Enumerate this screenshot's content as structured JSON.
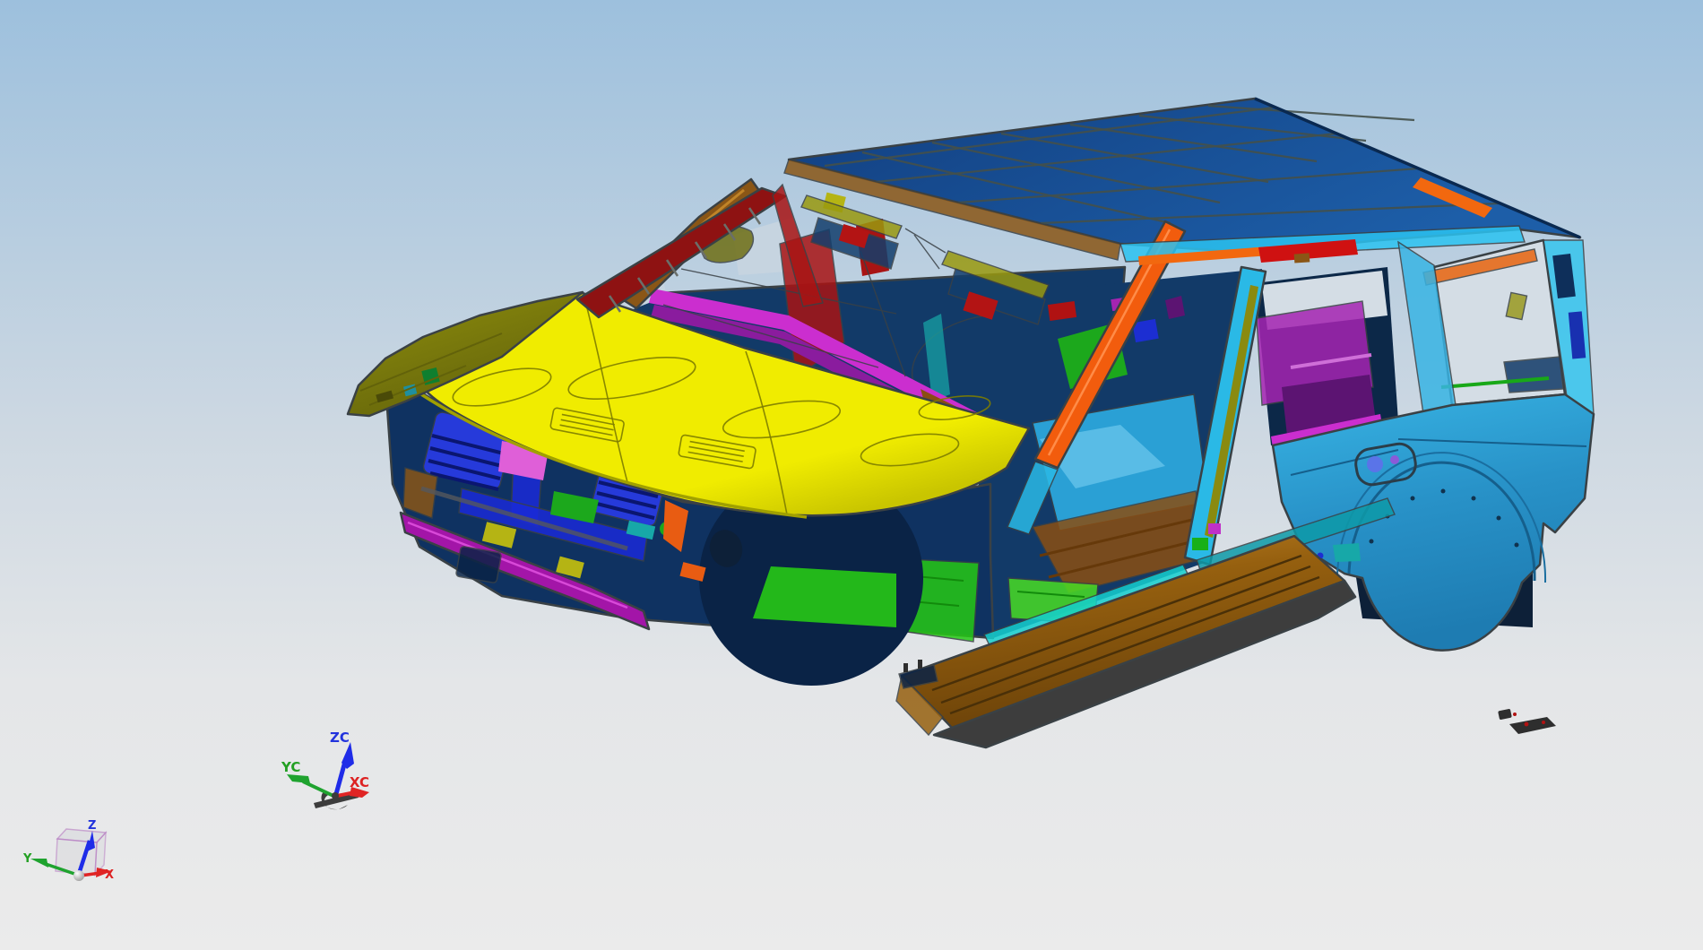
{
  "scene": {
    "description": "3D CAD viewport showing automotive body-in-white assembly",
    "wcs_triad": {
      "z_label": "ZC",
      "y_label": "YC",
      "x_label": "XC"
    },
    "abs_triad": {
      "z_label": "Z",
      "y_label": "Y",
      "x_label": "X"
    }
  },
  "palette": {
    "bg_top": "#9dc0dd",
    "bg_mid": "#cdd8e2",
    "bg_low": "#e4e6e8",
    "bg_bottom": "#ebebeb",
    "outline": "#3a4145",
    "roof_a": "#123f80",
    "roof_b": "#1d5ea8",
    "roof_grid": "#44504a",
    "roof_edge": "#0a2950",
    "rail_brown": "#8a5616",
    "rail_brown_dark": "#5e3a0e",
    "header_olive": "#99990f",
    "header_navy": "#133e6c",
    "header_red": "#b31414",
    "apillar_red": "#8e1212",
    "apillar_orange": "#f25c0d",
    "hood": "#f0ec00",
    "hood_dark": "#c9c500",
    "hood_line": "#7d7d00",
    "fender_olive": "#90900e",
    "fender_olive_dark": "#62620a",
    "interior_navy": "#123a68",
    "interior_deep": "#0c2848",
    "int_red": "#a81414",
    "wh_green_a": "#3fd02c",
    "wh_green_b": "#0c6a10",
    "cowl_magenta": "#cb2ecf",
    "cowl_purple": "#8a1c9e",
    "grille_blue": "#1a2ad8",
    "slat_blue": "#2b3cf0",
    "slat_dark": "#0a1670",
    "bumper_magenta": "#a315a8",
    "bumper_hi": "#d848d8",
    "eng_pink": "#df5fd8",
    "eng_green": "#1ca81c",
    "eng_yellow": "#b5b414",
    "eng_teal": "#17a8a8",
    "eng_orange": "#e85c12",
    "navy_struct": "#0f3261",
    "navy_deep": "#0a2346",
    "floor_green": "#26c915",
    "floor_green2": "#49dd25",
    "sill_cyan": "#15cfcf",
    "sill_cyan_dark": "#0e9aa8",
    "runb_top": "#96600f",
    "runb_hi": "#c08428",
    "runb_side": "#6b4209",
    "runb_under": "#3d3d3d",
    "floor_cyan": "#2fb2e8",
    "floor_brown": "#8a4e12",
    "floor_brown_dark": "#66390a",
    "cant_cyan": "#2bc3f1",
    "cant_red": "#cf1111",
    "cant_orange": "#f2680f",
    "bp_cyan": "#2ab9e6",
    "bp_olive": "#8a8a10",
    "sky_open": "#c6d4e0",
    "sky_open2": "#d4dde5",
    "q_top": "#38b4e4",
    "q_main": "#2892c8",
    "q_low": "#1e7cb2",
    "q_line": "#155f8c",
    "dp_cyan": "#36c5ee",
    "trim_magenta": "#a524b2",
    "trim_purple": "#5c1472",
    "arch_dark": "#0d2038",
    "archbox_blue": "#1c2ed2",
    "arch_magenta": "#c924c9",
    "brk_orange": "#e8650f",
    "plate_olive": "#9a9a20",
    "part_dark": "#2e2e2e",
    "part_red": "#b01212",
    "wcs_blue": "#1f2ce8",
    "wcs_green": "#1fa32f",
    "wcs_red": "#e02424",
    "handle_gray": "#3c3c3c",
    "cube_edge": "#b478c0",
    "cube_face": "#d9dadd",
    "sphere_b": "#8c8c8c",
    "label_blue": "#2233dd",
    "label_green": "#23a023",
    "label_red": "#dd2222"
  }
}
